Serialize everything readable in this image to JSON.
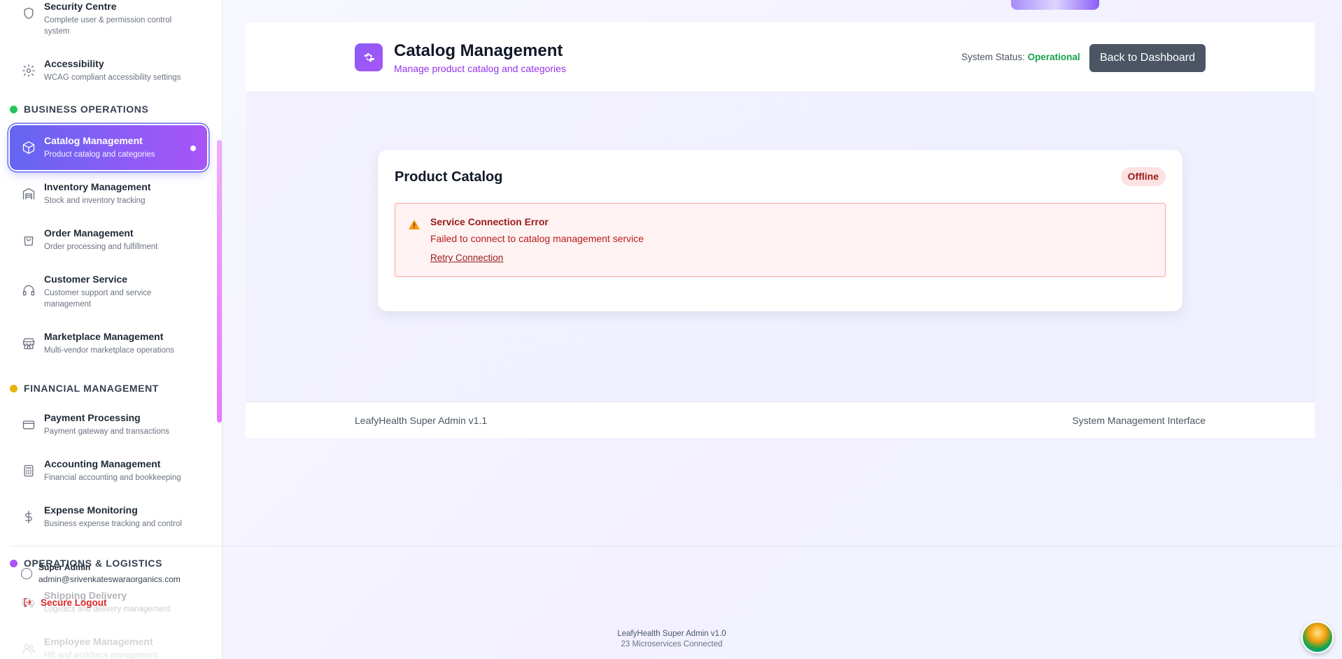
{
  "sidebar": {
    "top_items": [
      {
        "title": "Security Centre",
        "desc": "Complete user & permission control system",
        "icon": "shield-icon"
      },
      {
        "title": "Accessibility",
        "desc": "WCAG compliant accessibility settings",
        "icon": "gear-icon"
      }
    ],
    "sections": [
      {
        "label": "BUSINESS OPERATIONS",
        "color": "#22c55e",
        "items": [
          {
            "title": "Catalog Management",
            "desc": "Product catalog and categories",
            "icon": "package-icon",
            "active": true
          },
          {
            "title": "Inventory Management",
            "desc": "Stock and inventory tracking",
            "icon": "warehouse-icon"
          },
          {
            "title": "Order Management",
            "desc": "Order processing and fulfillment",
            "icon": "shopping-bag-icon"
          },
          {
            "title": "Customer Service",
            "desc": "Customer support and service management",
            "icon": "headphones-icon"
          },
          {
            "title": "Marketplace Management",
            "desc": "Multi-vendor marketplace operations",
            "icon": "store-icon"
          }
        ]
      },
      {
        "label": "FINANCIAL MANAGEMENT",
        "color": "#eab308",
        "items": [
          {
            "title": "Payment Processing",
            "desc": "Payment gateway and transactions",
            "icon": "credit-card-icon"
          },
          {
            "title": "Accounting Management",
            "desc": "Financial accounting and bookkeeping",
            "icon": "calculator-icon"
          },
          {
            "title": "Expense Monitoring",
            "desc": "Business expense tracking and control",
            "icon": "dollar-icon"
          }
        ]
      },
      {
        "label": "OPERATIONS & LOGISTICS",
        "color": "#a855f7",
        "items": [
          {
            "title": "Shipping Delivery",
            "desc": "Logistics and delivery management",
            "icon": "truck-icon"
          },
          {
            "title": "Employee Management",
            "desc": "HR and workforce management",
            "icon": "users-icon"
          }
        ]
      }
    ],
    "user": {
      "name": "Super Admin",
      "email": "admin@srivenkateswaraorganics.com"
    },
    "logout_label": "Secure Logout"
  },
  "header": {
    "title": "Catalog Management",
    "subtitle": "Manage product catalog and categories",
    "status_label": "System Status:",
    "status_value": "Operational",
    "back_button": "Back to Dashboard"
  },
  "catalog": {
    "title": "Product Catalog",
    "badge": "Offline",
    "error_title": "Service Connection Error",
    "error_message": "Failed to connect to catalog management service",
    "retry_label": "Retry Connection"
  },
  "footer": {
    "left": "LeafyHealth Super Admin v1.1",
    "right": "System Management Interface",
    "bottom_line1": "LeafyHealth Super Admin v1.0",
    "bottom_line2": "23 Microservices Connected"
  },
  "colors": {
    "accent": "#8b5cf6",
    "status_ok": "#16a34a",
    "error": "#991b1b"
  }
}
